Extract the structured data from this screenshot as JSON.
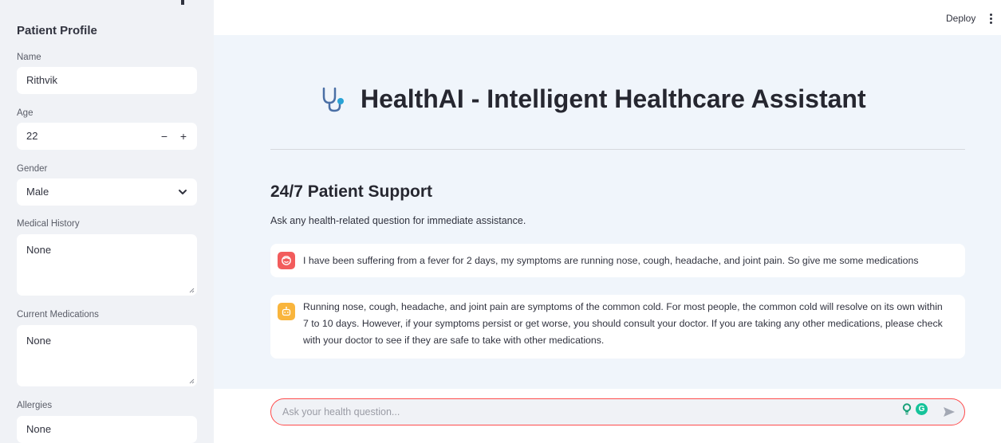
{
  "sidebar": {
    "title": "Patient Profile",
    "name": {
      "label": "Name",
      "value": "Rithvik"
    },
    "age": {
      "label": "Age",
      "value": "22",
      "decrement": "−",
      "increment": "+"
    },
    "gender": {
      "label": "Gender",
      "value": "Male"
    },
    "medical_history": {
      "label": "Medical History",
      "value": "None"
    },
    "current_medications": {
      "label": "Current Medications",
      "value": "None"
    },
    "allergies": {
      "label": "Allergies",
      "value": "None"
    }
  },
  "header": {
    "deploy_label": "Deploy",
    "menu_icon": "kebab-menu-icon"
  },
  "main": {
    "title": "HealthAI - Intelligent Healthcare Assistant",
    "title_icon": "stethoscope-icon",
    "section_title": "24/7 Patient Support",
    "subtitle": "Ask any health-related question for immediate assistance.",
    "messages": [
      {
        "role": "user",
        "avatar_icon": "user-face-icon",
        "text": "I have been suffering from a fever for 2 days, my symptoms are running nose, cough, headache, and joint pain. So give me some medications"
      },
      {
        "role": "assistant",
        "avatar_icon": "robot-icon",
        "text": "Running nose, cough, headache, and joint pain are symptoms of the common cold. For most people, the common cold will resolve on its own within 7 to 10 days. However, if your symptoms persist or get worse, you should consult your doctor. If you are taking any other medications, please check with your doctor to see if they are safe to take with other medications."
      }
    ]
  },
  "chat_input": {
    "placeholder": "Ask your health question...",
    "send_icon": "send-icon",
    "grammarly_glyph": "G"
  },
  "colors": {
    "accent": "#ff4b4b",
    "main_bg": "#f0f5fb",
    "sidebar_bg": "#f0f2f6",
    "user_avatar": "#f25c5c",
    "assistant_avatar": "#f9b53d"
  }
}
